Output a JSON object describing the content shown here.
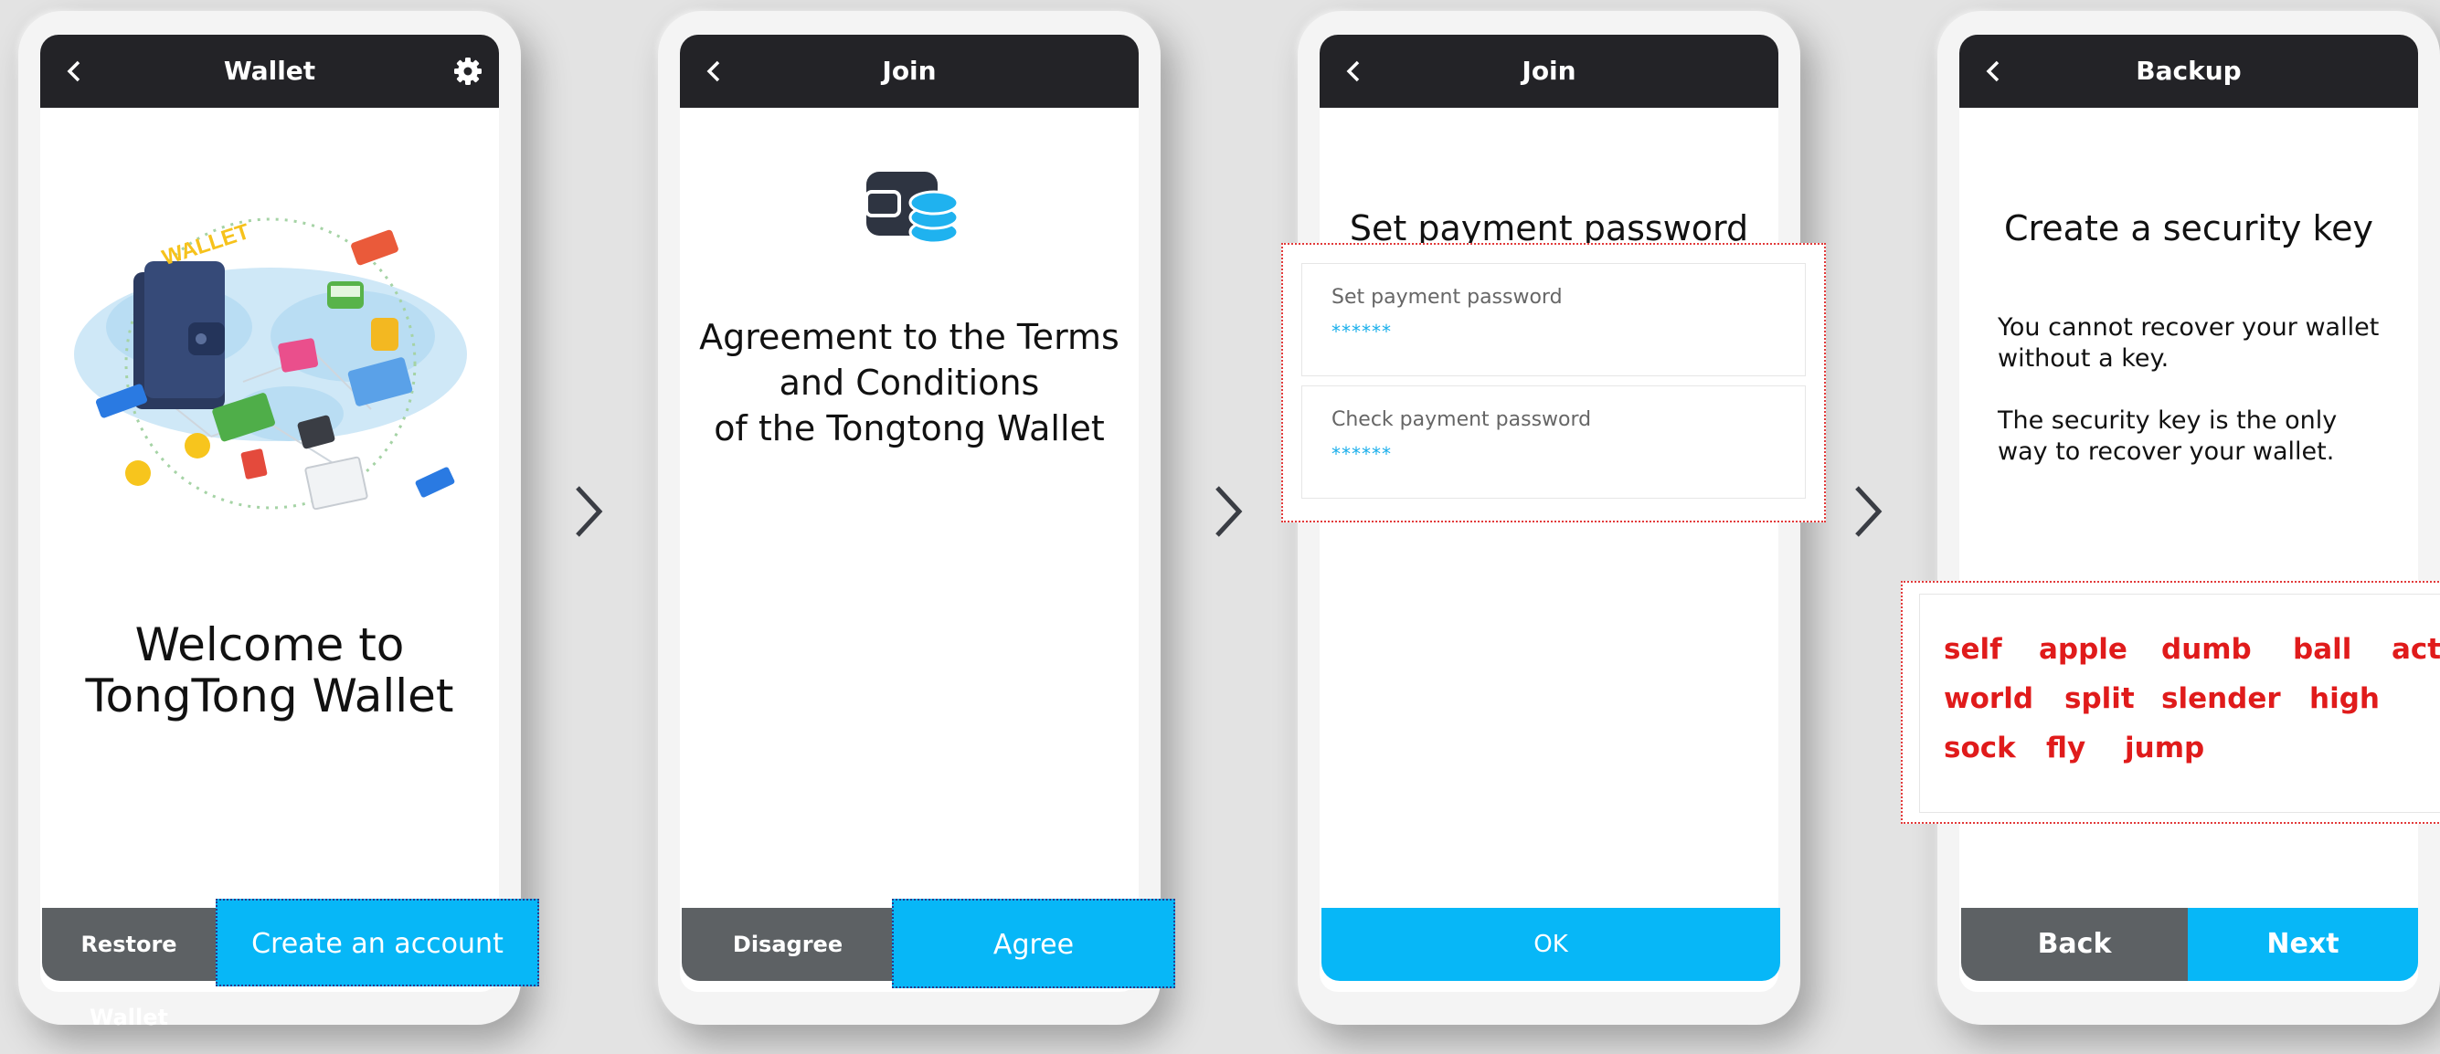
{
  "screens": [
    {
      "title": "Wallet",
      "welcome": "Welcome to\nTongTong Wallet",
      "illustration_text": "WALLET",
      "buttons": {
        "restore": "Restore Wallet",
        "create": "Create an account"
      }
    },
    {
      "title": "Join",
      "heading": "Agreement to the Terms\nand Conditions\nof the Tongtong Wallet",
      "buttons": {
        "disagree": "Disagree",
        "agree": "Agree"
      }
    },
    {
      "title": "Join",
      "heading": "Set payment password",
      "fields": [
        {
          "label": "Set payment password",
          "value": "******"
        },
        {
          "label": "Check payment password",
          "value": "******"
        }
      ],
      "buttons": {
        "ok": "OK"
      }
    },
    {
      "title": "Backup",
      "heading": "Create a security key",
      "paragraphs": [
        "You cannot recover your wallet without a key.",
        "The security key is the only way to recover your wallet."
      ],
      "key_words": [
        "self",
        "apple",
        "dumb",
        "ball",
        "act",
        "world",
        "split",
        "slender",
        "high",
        "sock",
        "fly",
        "jump"
      ],
      "buttons": {
        "back": "Back",
        "next": "Next"
      }
    }
  ],
  "colors": {
    "topbar": "#232327",
    "accent": "#07b7f7",
    "bottombar_grey": "#5d6164",
    "dotted_highlight": "#e23a3a",
    "key_word": "#e01b1b",
    "background": "#e3e3e3"
  },
  "icons": [
    "back-icon",
    "gear-icon",
    "wallet-database-icon",
    "chevron-right-icon"
  ]
}
